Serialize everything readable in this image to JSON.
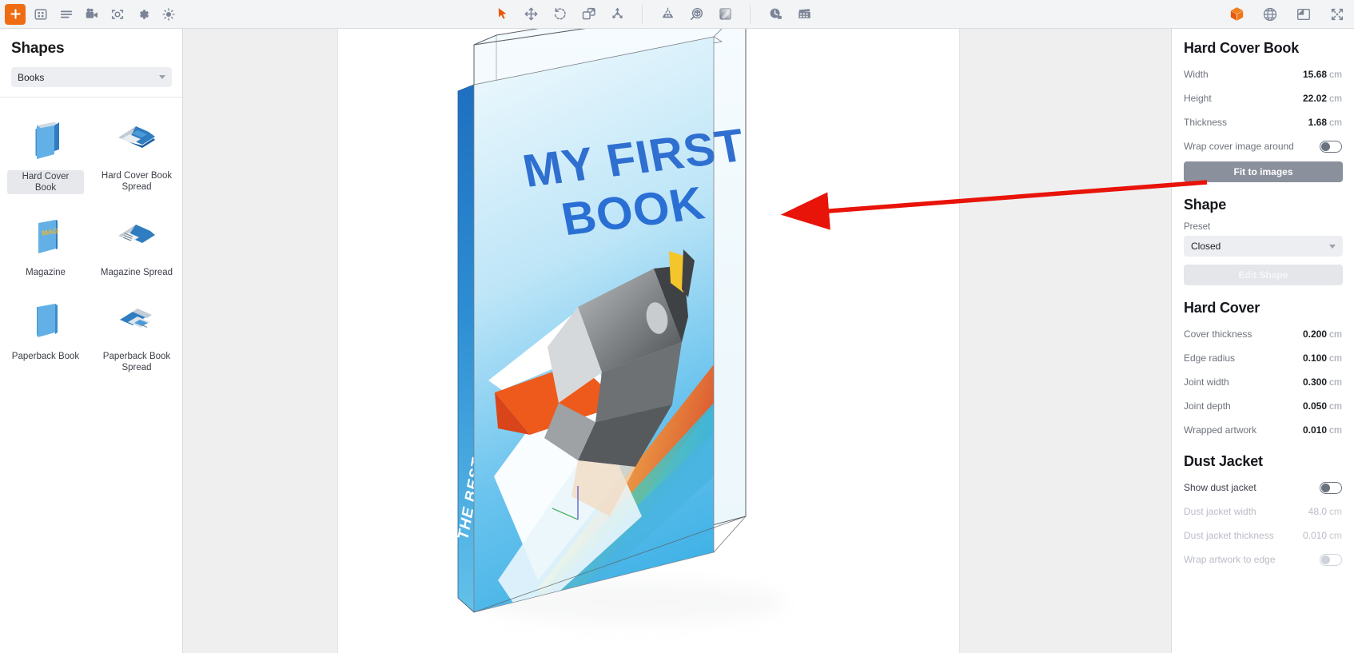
{
  "toolbar": {
    "left": [
      {
        "name": "add-icon",
        "title": "Add"
      },
      {
        "name": "grid-icon",
        "title": "Layout"
      },
      {
        "name": "list-icon",
        "title": "List"
      },
      {
        "name": "video-camera-icon",
        "title": "Animation"
      },
      {
        "name": "snapshot-icon",
        "title": "Snapshot"
      },
      {
        "name": "gear-icon",
        "title": "Settings"
      },
      {
        "name": "light-bulb-icon",
        "title": "Lighting"
      }
    ],
    "center": [
      {
        "name": "cursor-select-icon",
        "title": "Select"
      },
      {
        "name": "move-icon",
        "title": "Move"
      },
      {
        "name": "rotate-icon",
        "title": "Rotate"
      },
      {
        "name": "scale-icon",
        "title": "Scale"
      },
      {
        "name": "distribute-icon",
        "title": "Distribute"
      },
      {
        "name": "spotlight-icon",
        "title": "Light"
      },
      {
        "name": "environment-icon",
        "title": "Environment"
      },
      {
        "name": "gradient-icon",
        "title": "Backdrop"
      },
      {
        "name": "timeline-icon",
        "title": "Timeline"
      },
      {
        "name": "film-icon",
        "title": "Film"
      }
    ],
    "right": [
      {
        "name": "cube-3d-icon",
        "title": "3D View"
      },
      {
        "name": "sphere-icon",
        "title": "Materials"
      },
      {
        "name": "panel-layout-icon",
        "title": "Panels"
      },
      {
        "name": "fullscreen-icon",
        "title": "Fullscreen"
      }
    ],
    "accent_color": "#ef6c12",
    "icon_color": "#7b8496"
  },
  "shapes_panel": {
    "title": "Shapes",
    "category": {
      "value": "Books",
      "placeholder": "Books"
    },
    "items": [
      {
        "label": "Hard Cover Book",
        "selected": true,
        "thumb": "book-closed-thumb"
      },
      {
        "label": "Hard Cover Book Spread",
        "selected": false,
        "thumb": "book-spread-thumb"
      },
      {
        "label": "Magazine",
        "selected": false,
        "thumb": "magazine-thumb"
      },
      {
        "label": "Magazine Spread",
        "selected": false,
        "thumb": "magazine-spread-thumb"
      },
      {
        "label": "Paperback Book",
        "selected": false,
        "thumb": "paperback-thumb"
      },
      {
        "label": "Paperback Book Spread",
        "selected": false,
        "thumb": "paperback-spread-thumb"
      }
    ]
  },
  "viewport": {
    "book": {
      "cover_title_line1": "MY FIRST",
      "cover_title_line2": "BOOK",
      "spine_text": "THE BEST BOOK EVER",
      "cover_title_color": "#2a6fd4",
      "spine_color": "#1565c0",
      "cover_bg_top": "#e9f6fc",
      "cover_bg_bottom": "#4ab7ea"
    },
    "annotation": {
      "name": "red-arrow-annotation",
      "color": "#e81309",
      "points_from": "Fit to images",
      "points_to": "book right edge"
    }
  },
  "properties": {
    "object": {
      "title": "Hard Cover Book",
      "rows": [
        {
          "label": "Width",
          "value": "15.68",
          "unit": "cm",
          "dim": false
        },
        {
          "label": "Height",
          "value": "22.02",
          "unit": "cm",
          "dim": false
        },
        {
          "label": "Thickness",
          "value": "1.68",
          "unit": "cm",
          "dim": false
        }
      ],
      "wrap_toggle_label": "Wrap cover image around",
      "wrap_toggle_on": false,
      "fit_button": "Fit to images"
    },
    "shape": {
      "title": "Shape",
      "preset_label": "Preset",
      "preset_value": "Closed",
      "edit_button": "Edit Shape",
      "edit_enabled": false
    },
    "hard_cover": {
      "title": "Hard Cover",
      "rows": [
        {
          "label": "Cover thickness",
          "value": "0.200",
          "unit": "cm",
          "dim": false
        },
        {
          "label": "Edge radius",
          "value": "0.100",
          "unit": "cm",
          "dim": false
        },
        {
          "label": "Joint width",
          "value": "0.300",
          "unit": "cm",
          "dim": false
        },
        {
          "label": "Joint depth",
          "value": "0.050",
          "unit": "cm",
          "dim": false
        },
        {
          "label": "Wrapped artwork",
          "value": "0.010",
          "unit": "cm",
          "dim": false
        }
      ]
    },
    "dust_jacket": {
      "title": "Dust Jacket",
      "show_label": "Show dust jacket",
      "show_on": false,
      "rows": [
        {
          "label": "Dust jacket width",
          "value": "48.0",
          "unit": "cm",
          "dim": true
        },
        {
          "label": "Dust jacket thickness",
          "value": "0.010",
          "unit": "cm",
          "dim": true
        }
      ],
      "wrap_edge_label": "Wrap artwork to edge",
      "wrap_edge_on": false
    }
  }
}
